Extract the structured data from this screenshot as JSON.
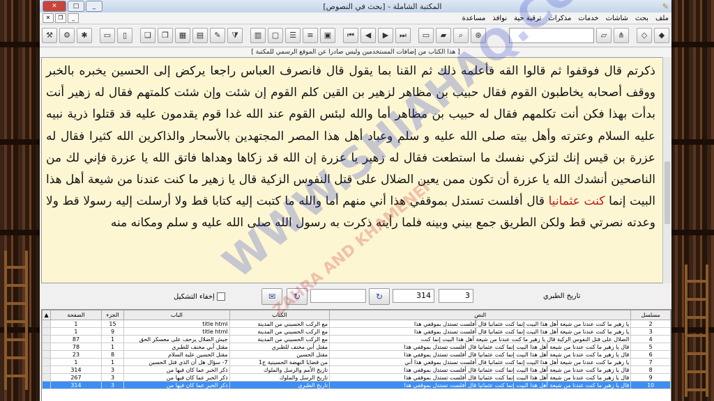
{
  "window": {
    "title": "المكتبة الشاملة - [بحث في النصوص]",
    "controls": [
      "_",
      "□",
      "✕"
    ]
  },
  "menu": [
    "ملف",
    "بحث",
    "شاشات",
    "خدمات",
    "مذكرات",
    "ترقية حية",
    "نوافذ",
    "مساعدة"
  ],
  "notice": "[ هذا الكتاب من إضافات المستخدمين وليس صادرا عن الموقع الرسمي للمكتبة ]",
  "text_pane": {
    "before_highlight": "ذكرتم قال فوقفوا ثم قالوا القه فأعلمه ذلك ثم القنا بما يقول قال فانصرف العباس راجعا يركض إلى الحسين يخبره بالخبر ووقف أصحابه يخاطبون القوم فقال حبيب بن مظاهر لزهير بن القين كلم القوم إن شئت وإن شئت كلمتهم فقال له زهير أنت بدأت بهذا فكن أنت تكلمهم فقال له حبيب بن مظاهر أما والله لبئس القوم عند الله غدا قوم يقدمون عليه قد قتلوا ذرية نبيه عليه السلام وعترته وأهل بيته صلى الله عليه و سلم وعباد أهل هذا المصر المجتهدين بالأسحار والذاكرين الله كثيرا فقال له عزرة بن قيس إنك لتزكي نفسك ما استطعت فقال له زهير يا عزرة إن الله قد زكاها وهداها فاتق الله يا عزرة فإني لك من الناصحين أنشدك الله يا عزرة أن تكون ممن يعين الضلال على قتل النفوس الزكية قال يا زهير ما كنت عندنا من شيعة أهل هذا البيت إنما ",
    "highlight": "كنت عثمانيا",
    "after_highlight": " قال أفلست تستدل بموقفي هذا أني منهم أما والله ما كتبت إليه كتابا قط ولا أرسلت إليه رسولا قط ولا وعدته نصرتي قط ولكن الطريق جمع بيني وبينه فلما رأيته ذكرت به رسول الله صلى الله عليه و سلم ومكانه منه"
  },
  "controls": {
    "hide_diacritics_label": "إخفاء التشكيل",
    "page_value": "314",
    "part_value": "3",
    "book_name": "تاريخ الطبري"
  },
  "watermark": {
    "main": "WWW.SHIAHAQ.COM",
    "sub": "ZAHRA AND KHAMENEI"
  },
  "results": {
    "columns": [
      "الصفحة",
      "الجزء",
      "الباب",
      "الكتاب",
      "النص",
      "مسلسل"
    ],
    "rows": [
      {
        "page": "1",
        "part": "15",
        "chapter": "title html",
        "book": "مع الركب الحسيني من المدينة",
        "text": "يا زهير ما كنت عندنا من شيعة أهل هذا البيت إنما كنت عثمانيا قال أفلست تستدل بموقفي هذا",
        "serial": "2"
      },
      {
        "page": "1",
        "part": "9",
        "chapter": "title html",
        "book": "مع الركب الحسيني من المدينة",
        "text": "يا زهير ما كنت عندنا من شيعة أهل هذا البيت إنما كنت عثمانيا قال أفلست تستدل بموقفي هذا",
        "serial": "3"
      },
      {
        "page": "87",
        "part": "1",
        "chapter": "جيش الضلال يزحف على معسكر الحق",
        "book": "مع الركب الحسيني من المدينة",
        "text": "الضلال على قتل النفوس الزكية قال يا زهير ما كنت عندنا من شيعة أهل هذا البيت إنما كنت",
        "serial": "4"
      },
      {
        "page": "78",
        "part": "1",
        "chapter": "مقتل أبي مخنف للطبري",
        "book": "مقتل أبي مخنف للطبري",
        "text": "قال يا زهير ما كنت عندنا من شيعة أهل هذا البيت إنما كنت عثمانيا قال أفلست تستدل بموقفي هذا",
        "serial": "5"
      },
      {
        "page": "23",
        "part": "8",
        "chapter": "مقتل الحسين عليه السلام",
        "book": "مقتل الحسين",
        "text": "قال يا زهير ما كنت عندنا من شيعة أهل هذا البيت إنما كنت عثمانيا قال أفلست تستدل بموقفي هذا",
        "serial": "6"
      },
      {
        "page": "1",
        "part": "1",
        "chapter": "7- سؤال هل أن الذي قتل الحسين",
        "book": "من قضايا النهضة الحسينية ج1",
        "text": "يا زهير ما كنت عندنا من شيعة أهل هذا البيت إنما كنت عثمانيا قال أفلست تستدل بموقفي هذا أني",
        "serial": "7"
      },
      {
        "page": "314",
        "part": "3",
        "chapter": "ذكر الخبر عما كان فيها من",
        "book": "تاريخ الأمم والرسل والملوك",
        "text": "قال يا زهير ما كنت عندنا من شيعة أهل هذا البيت إنما كنت عثمانيا قال أفلست تستدل بموقفي هذا",
        "serial": "8"
      },
      {
        "page": "267",
        "part": "3",
        "chapter": "ذكر الخبر عما كان فيها من",
        "book": "تاريخ الرسل والملوك",
        "text": "قال يا زهير ما كنت عندنا من شيعة أهل هذا البيت إنما كنت عثمانيا قال أفلست تستدل بموقفي هذا",
        "serial": "9"
      },
      {
        "page": "314",
        "part": "3",
        "chapter": "ذكر الخبر عما كان فيها من",
        "book": "تاريخ الطبري",
        "text": "قال يا زهير ما كنت عندنا من شيعة أهل هذا البيت إنما كنت عثمانيا قال أفلست تستدل بموقفي هذا",
        "serial": "10"
      }
    ]
  }
}
